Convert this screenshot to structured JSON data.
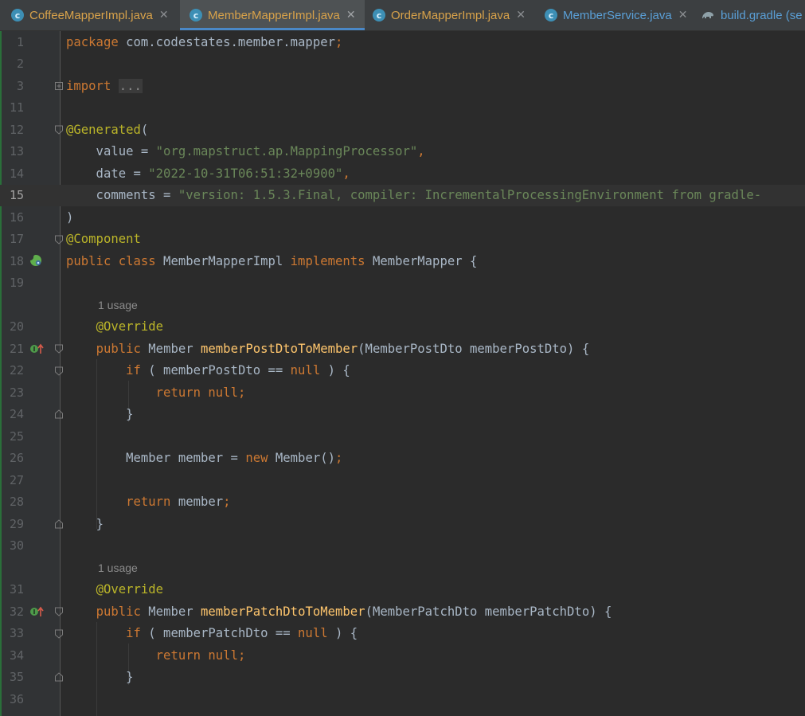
{
  "tabs": [
    {
      "label": "CoffeeMapperImpl.java",
      "icon": "java-class-icon",
      "active": false,
      "color": "#d8a24a"
    },
    {
      "label": "MemberMapperImpl.java",
      "icon": "java-class-icon",
      "active": true,
      "color": "#d8a24a"
    },
    {
      "label": "OrderMapperImpl.java",
      "icon": "java-class-icon",
      "active": false,
      "color": "#d8a24a"
    },
    {
      "label": "MemberService.java",
      "icon": "java-class-icon",
      "active": false,
      "color": "#5a9fd6"
    },
    {
      "label": "build.gradle (se",
      "icon": "gradle-icon",
      "active": false,
      "color": "#5a9fd6"
    }
  ],
  "close_glyph": "✕",
  "class_icon_glyph": "c",
  "current_line": "15",
  "usage_hint": "1 usage",
  "line_numbers": [
    "1",
    "2",
    "3",
    "11",
    "12",
    "13",
    "14",
    "15",
    "16",
    "17",
    "18",
    "19",
    "20",
    "21",
    "22",
    "23",
    "24",
    "25",
    "26",
    "27",
    "28",
    "29",
    "30",
    "31",
    "32",
    "33",
    "34",
    "35",
    "36"
  ],
  "code": {
    "l1_kw": "package",
    "l1_rest": " com.codestates.member.mapper",
    "semi": ";",
    "l3_kw": "import",
    "l3_folded": "...",
    "l12_ann": "@Generated",
    "l12_paren": "(",
    "l13_key": "    value = ",
    "l13_str": "\"org.mapstruct.ap.MappingProcessor\"",
    "comma": ",",
    "l14_key": "    date = ",
    "l14_str": "\"2022-10-31T06:51:32+0900\"",
    "l15_key": "    comments = ",
    "l15_str": "\"version: 1.5.3.Final, compiler: IncrementalProcessingEnvironment from gradle-",
    "l16": ")",
    "l17_ann": "@Component",
    "l18_kw1": "public class",
    "l18_name": " MemberMapperImpl ",
    "l18_kw2": "implements",
    "l18_rest": " MemberMapper {",
    "override": "@Override",
    "public": "public",
    "member_type": " Member ",
    "l21_fn": "memberPostDtoToMember",
    "l21_rest": "(MemberPostDto memberPostDto) {",
    "if": "if",
    "l22_mid": " ( memberPostDto == ",
    "null": "null",
    "close_if": " ) {",
    "return": "return",
    "return_null": " null",
    "close_brace": "}",
    "l26_a": "Member member = ",
    "new": "new",
    "l26_b": " Member()",
    "l28_rest": " member",
    "l32_fn": "memberPatchDtoToMember",
    "l32_rest": "(MemberPatchDto memberPatchDto) {",
    "l33_mid": " ( memberPatchDto == "
  },
  "colors": {
    "background": "#2b2b2b",
    "keyword": "#cc7832",
    "string": "#6a8759",
    "annotation": "#bbb529",
    "method": "#ffc66d",
    "text": "#a9b7c6",
    "accent": "#4a88c7"
  }
}
